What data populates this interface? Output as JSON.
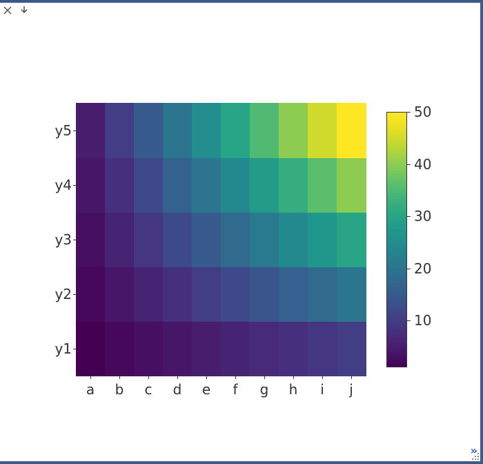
{
  "toolbar": {
    "close_label": "×",
    "download_label": "⇩"
  },
  "chart_data": {
    "type": "heatmap",
    "x_categories": [
      "a",
      "b",
      "c",
      "d",
      "e",
      "f",
      "g",
      "h",
      "i",
      "j"
    ],
    "y_categories": [
      "y1",
      "y2",
      "y3",
      "y4",
      "y5"
    ],
    "values": [
      [
        1,
        2,
        3,
        4,
        5,
        6,
        7,
        8,
        9,
        10
      ],
      [
        2,
        4,
        6,
        8,
        10,
        12,
        14,
        16,
        18,
        20
      ],
      [
        3,
        6,
        9,
        12,
        15,
        18,
        21,
        24,
        27,
        30
      ],
      [
        4,
        8,
        12,
        16,
        20,
        24,
        28,
        32,
        36,
        40
      ],
      [
        5,
        10,
        15,
        20,
        25,
        30,
        35,
        40,
        45,
        50
      ]
    ],
    "vmin": 1,
    "vmax": 50,
    "colormap": "viridis",
    "colorbar_ticks": [
      10,
      20,
      30,
      40,
      50
    ]
  },
  "footer": {
    "more_label": "»"
  }
}
